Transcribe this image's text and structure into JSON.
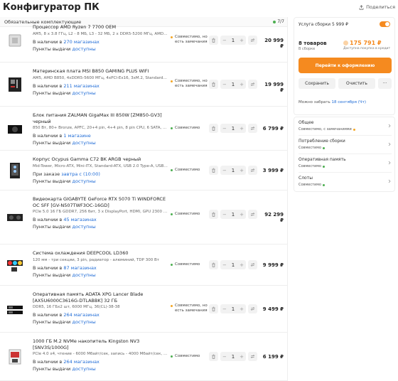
{
  "page": {
    "title": "Конфигуратор ПК",
    "share_label": "Поделиться"
  },
  "list": {
    "header": "Обязательные комплектующие",
    "count": "7/7"
  },
  "items": [
    {
      "name": "Процессор AMD Ryzen 7 7700 OEM",
      "specs": "AM5, 8 x 3.8 ГГц, L2 - 8 МБ, L3 - 32 МБ, 2 x DDR5-5200 МГц, AMD Radeon...",
      "stock_prefix": "В наличии в ",
      "stock_link": "270 магазинах",
      "pickup_prefix": "Пункты выдачи ",
      "pickup_link": "доступны",
      "compat": "Совместимо, но есть замечания",
      "compat_color": "#f5a623",
      "qty": "1",
      "price": "20 999 ₽",
      "icon": "cpu-icon"
    },
    {
      "name": "Материнская плата MSI B850 GAMING PLUS WIFI",
      "specs": "AM5, AMD B850, 4xDDR5-5600 МГц, 4xPCI-Ex16, 3xM.2, Standard-ATX",
      "stock_prefix": "В наличии в ",
      "stock_link": "211 магазинах",
      "pickup_prefix": "Пункты выдачи ",
      "pickup_link": "доступны",
      "compat": "Совместимо, но есть замечания",
      "compat_color": "#f5a623",
      "qty": "1",
      "price": "19 999 ₽",
      "icon": "motherboard-icon"
    },
    {
      "name": "Блок питания ZALMAN GigaMax III 850W [ZM850-GV3] черный",
      "specs": "850 Вт, 80+ Bronze, APFC, 20+4 pin, 4+4 pin, 8 pin CPU, 6 SATA, 16 pin (12...",
      "stock_prefix": "В наличии в ",
      "stock_link": "1 магазине",
      "pickup_prefix": "Пункты выдачи ",
      "pickup_link": "доступны",
      "compat": "Совместимо",
      "compat_color": "#4caf50",
      "qty": "1",
      "price": "6 799 ₽",
      "icon": "psu-icon"
    },
    {
      "name": "Корпус Ocypus Gamma C72 BK ARGB черный",
      "specs": "Mid-Tower, Micro-ATX, Mini-ITX, Standard-ATX, USB 2.0 Type-A, USB 3.2 G...",
      "stock_prefix": "При заказе ",
      "stock_link": "завтра с (10:00)",
      "pickup_prefix": "Пункты выдачи ",
      "pickup_link": "доступны",
      "compat": "Совместимо",
      "compat_color": "#4caf50",
      "qty": "1",
      "price": "3 999 ₽",
      "icon": "case-icon"
    },
    {
      "name": "Видеокарта GIGABYTE GeForce RTX 5070 Ti WINDFORCE OC SFF [GV-N507TWF3OC-16GD]",
      "specs": "PCIe 5.0 16 ГБ GDDR7, 256 бит, 3 x DisplayPort, HDMI, GPU 2300 МГц",
      "stock_prefix": "В наличии в ",
      "stock_link": "45 магазинах",
      "pickup_prefix": "Пункты выдачи ",
      "pickup_link": "доступны",
      "compat": "Совместимо",
      "compat_color": "#4caf50",
      "qty": "1",
      "price": "92 299 ₽",
      "icon": "gpu-icon"
    },
    {
      "name": "Система охлаждения DEEPCOOL LD360",
      "specs": "120 мм - три секции, 3 pin, радиатор - алюминий, TDP 300 Вт",
      "stock_prefix": "В наличии в ",
      "stock_link": "87 магазинах",
      "pickup_prefix": "Пункты выдачи ",
      "pickup_link": "доступны",
      "compat": "Совместимо",
      "compat_color": "#4caf50",
      "qty": "1",
      "price": "9 999 ₽",
      "icon": "cooler-icon"
    },
    {
      "name": "Оперативная память ADATA XPG Lancer Blade [AX5U6000C3616G-DTLABBK] 32 ГБ",
      "specs": "DDR5, 16 ГБx2 шт, 6000 МГц, 36(CL)-38-38",
      "stock_prefix": "В наличии в ",
      "stock_link": "264 магазинах",
      "pickup_prefix": "Пункты выдачи ",
      "pickup_link": "доступны",
      "compat": "Совместимо, но есть замечания",
      "compat_color": "#f5a623",
      "qty": "1",
      "price": "9 499 ₽",
      "icon": "ram-icon"
    },
    {
      "name": "1000 ГБ M.2 NVMe накопитель Kingston NV3 [SNV3S/1000G]",
      "specs": "PCIe 4.0 x4, чтение - 6000 Мбайт/сек, запись - 4000 Мбайт/сек, 3 бит TL...",
      "stock_prefix": "В наличии в ",
      "stock_link": "264 магазинах",
      "pickup_prefix": "Пункты выдачи ",
      "pickup_link": "доступны",
      "compat": "Совместимо",
      "compat_color": "#4caf50",
      "qty": "1",
      "price": "6 199 ₽",
      "icon": "ssd-icon"
    }
  ],
  "summary": {
    "service_label": "Услуга сборки 5 999 ₽",
    "goods_count": "8 товаров",
    "goods_sub": "В сборке",
    "total": "175 791 ₽",
    "total_sub": "Доступна покупка в кредит",
    "checkout_label": "Перейти к оформлению",
    "save_label": "Сохранить",
    "clear_label": "Очистить",
    "more_label": "···",
    "delivery_prefix": "Можно забрать ",
    "delivery_link": "18 сентября (Чт)"
  },
  "checks": [
    {
      "label": "Общее",
      "status": "Совместимо, с замечаниями",
      "color": "#f5a623"
    },
    {
      "label": "Потребление сборки",
      "status": "Совместимо",
      "color": "#4caf50"
    },
    {
      "label": "Оперативная память",
      "status": "Совместимо",
      "color": "#4caf50"
    },
    {
      "label": "Слоты",
      "status": "Совместимо",
      "color": "#4caf50"
    }
  ]
}
